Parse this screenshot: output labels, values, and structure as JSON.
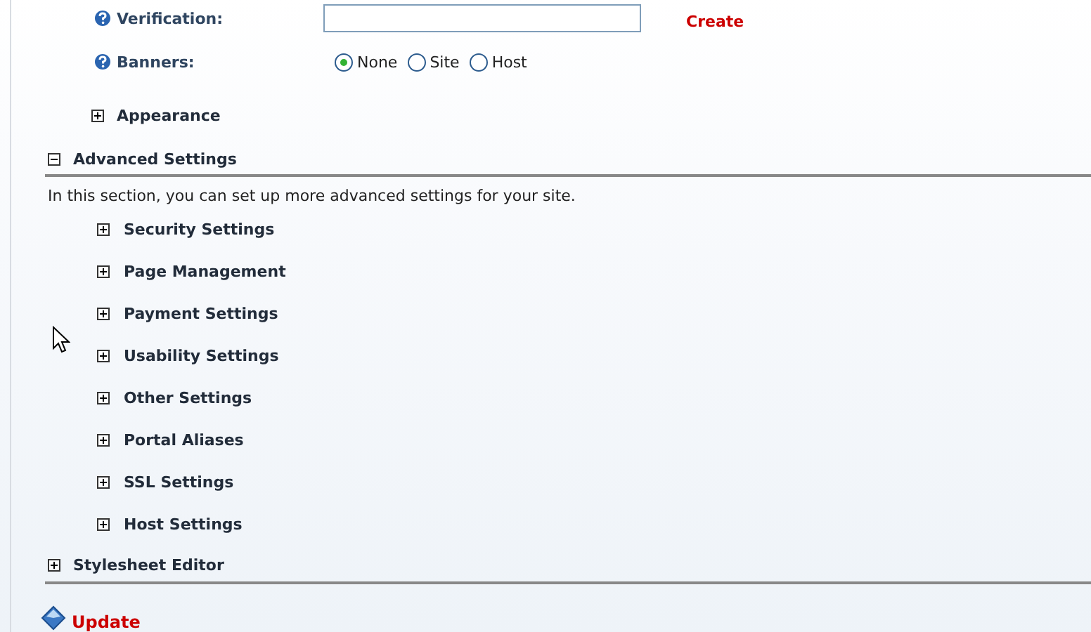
{
  "fields": [
    {
      "kind": "text",
      "label": "Verification:",
      "link": "Create"
    },
    {
      "kind": "radio",
      "label": "Banners:",
      "options": [
        {
          "label": "None",
          "selected": true
        },
        {
          "label": "Site",
          "selected": false
        },
        {
          "label": "Host",
          "selected": false
        }
      ]
    }
  ],
  "subsection": {
    "title": "Appearance",
    "expanded": false
  },
  "sections": [
    {
      "title": "Advanced Settings",
      "expanded": true,
      "description": "In this section, you can set up more advanced settings for your site.",
      "items": [
        {
          "title": "Security Settings",
          "expanded": false
        },
        {
          "title": "Page Management",
          "expanded": false
        },
        {
          "title": "Payment Settings",
          "expanded": false
        },
        {
          "title": "Usability Settings",
          "expanded": false
        },
        {
          "title": "Other Settings",
          "expanded": false
        },
        {
          "title": "Portal Aliases",
          "expanded": false
        },
        {
          "title": "SSL Settings",
          "expanded": false
        },
        {
          "title": "Host Settings",
          "expanded": false
        }
      ]
    },
    {
      "title": "Stylesheet Editor",
      "expanded": false
    }
  ],
  "update": "Update"
}
